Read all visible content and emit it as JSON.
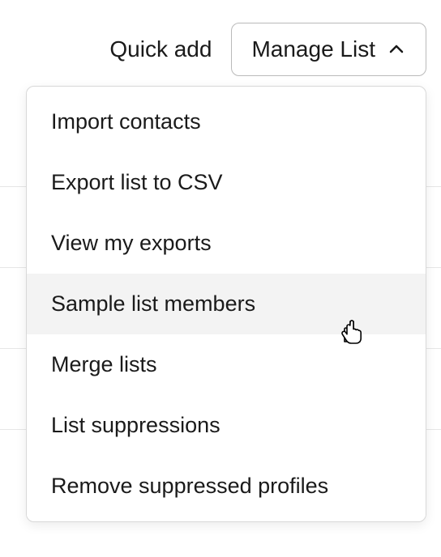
{
  "toolbar": {
    "quick_add_label": "Quick add",
    "manage_list_label": "Manage List"
  },
  "dropdown": {
    "items": [
      {
        "label": "Import contacts",
        "hovered": false
      },
      {
        "label": "Export list to CSV",
        "hovered": false
      },
      {
        "label": "View my exports",
        "hovered": false
      },
      {
        "label": "Sample list members",
        "hovered": true
      },
      {
        "label": "Merge lists",
        "hovered": false
      },
      {
        "label": "List suppressions",
        "hovered": false
      },
      {
        "label": "Remove suppressed profiles",
        "hovered": false
      }
    ]
  }
}
